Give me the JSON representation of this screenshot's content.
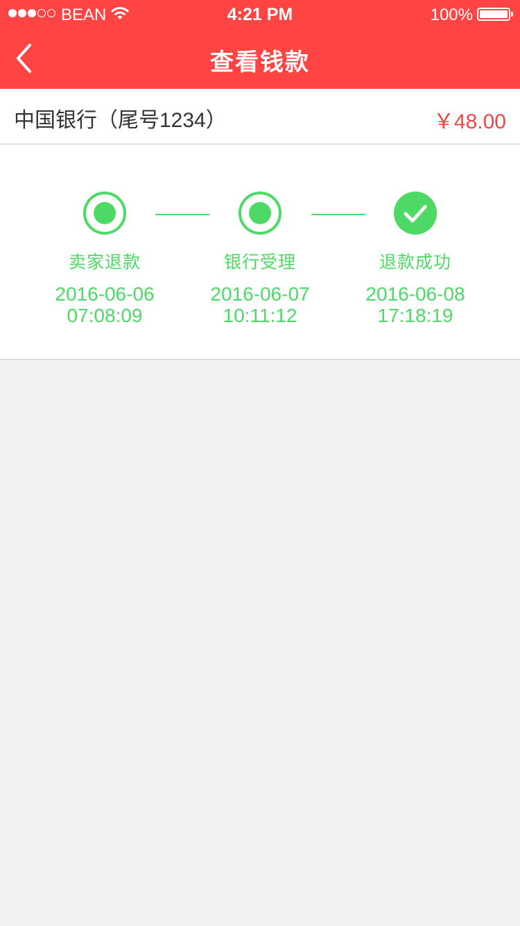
{
  "status_bar": {
    "carrier": "BEAN",
    "time": "4:21 PM",
    "battery": "100%"
  },
  "nav": {
    "title": "查看钱款",
    "back_icon": "chevron-left-icon"
  },
  "account": {
    "bank": "中国银行（尾号1234）",
    "amount": "￥48.00"
  },
  "steps": [
    {
      "label": "卖家退款",
      "date": "2016-06-06",
      "time": "07:08:09",
      "icon": "radio-dot-icon"
    },
    {
      "label": "银行受理",
      "date": "2016-06-07",
      "time": "10:11:12",
      "icon": "radio-dot-icon"
    },
    {
      "label": "退款成功",
      "date": "2016-06-08",
      "time": "17:18:19",
      "icon": "check-circle-icon"
    }
  ],
  "colors": {
    "header": "#ff4444",
    "accent": "#4cd964",
    "amount": "#f04545",
    "background": "#f2f2f2"
  }
}
